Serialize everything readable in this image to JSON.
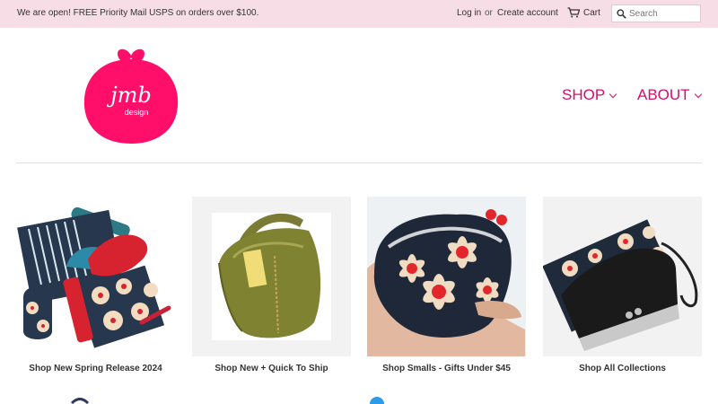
{
  "announcement": {
    "text": "We are open! FREE Priority Mail USPS on orders over $100.",
    "login_label": "Log in",
    "or_label": "or",
    "create_account_label": "Create account",
    "cart_label": "Cart",
    "search_placeholder": "Search"
  },
  "brand": {
    "logo_text_top": "jmb",
    "logo_text_bottom": "design",
    "accent_color": "#d40f68"
  },
  "nav": {
    "items": [
      {
        "label": "SHOP"
      },
      {
        "label": "ABOUT"
      }
    ]
  },
  "products": [
    {
      "title": "Shop New Spring Release 2024"
    },
    {
      "title": "Shop New + Quick To Ship"
    },
    {
      "title": "Shop Smalls - Gifts Under $45"
    },
    {
      "title": "Shop All Collections"
    }
  ]
}
